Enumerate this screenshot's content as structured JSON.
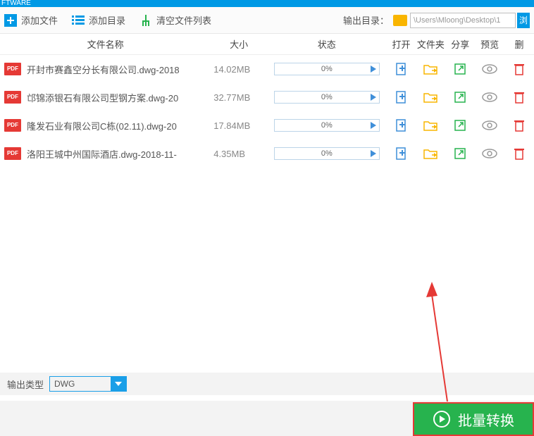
{
  "titlebar": "FTWARE",
  "toolbar": {
    "add_file": "添加文件",
    "add_dir": "添加目录",
    "clear_list": "清空文件列表",
    "output_label": "输出目录：",
    "output_path": "\\Users\\Mloong\\Desktop\\1",
    "browse": "浏"
  },
  "headers": {
    "name": "文件名称",
    "size": "大小",
    "status": "状态",
    "open": "打开",
    "folder": "文件夹",
    "share": "分享",
    "preview": "预览",
    "delete": "删"
  },
  "files": [
    {
      "name": "开封市赛鑫空分长有限公司.dwg-2018",
      "size": "14.02MB",
      "progress": "0%"
    },
    {
      "name": "邙锦添银石有限公司型钢方案.dwg-20",
      "size": "32.77MB",
      "progress": "0%"
    },
    {
      "name": "隆发石业有限公司C栋(02.11).dwg-20",
      "size": "17.84MB",
      "progress": "0%"
    },
    {
      "name": "洛阳王城中州国际酒店.dwg-2018-11-",
      "size": "4.35MB",
      "progress": "0%"
    }
  ],
  "file_badge": "PDF",
  "output_type": {
    "label": "输出类型",
    "value": "DWG"
  },
  "convert": "批量转换"
}
